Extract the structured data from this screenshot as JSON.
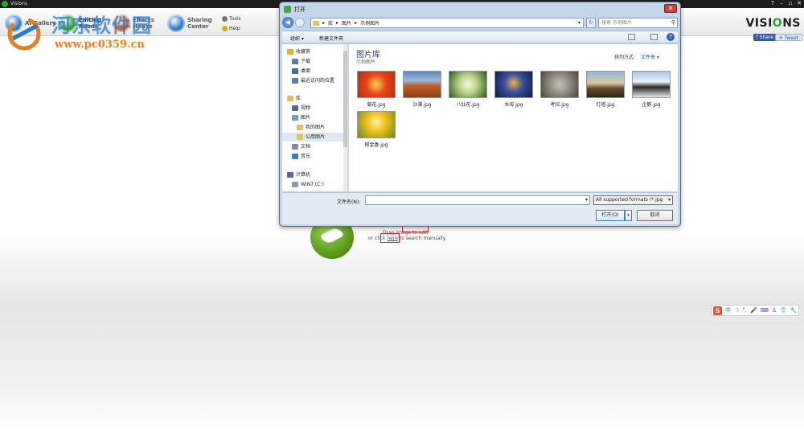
{
  "app": {
    "title": "Visions",
    "win_help": "?",
    "win_min": "–",
    "win_max": "▫",
    "win_close": "✕"
  },
  "toolbar": {
    "buttons": [
      {
        "label": "AI Gallery",
        "color": "#2a78c9"
      },
      {
        "label": "Editing Room",
        "color": "#2aa32a"
      },
      {
        "label": "Effects House",
        "color": "#d45a1e"
      },
      {
        "label": "Sharing Center",
        "color": "#2a78c9"
      }
    ],
    "tools_label": "Tools",
    "help_label": "Help"
  },
  "brand": {
    "text_left": "VISI",
    "text_o": "O",
    "text_right": "NS",
    "accent": "#2aa32a"
  },
  "social": {
    "facebook": "f Share",
    "twitter": "✈ Tweet"
  },
  "watermark": {
    "title": "河东软件园",
    "url": "www.pc0359.cn"
  },
  "drop_area": {
    "line1": "Drag image to edit",
    "line2_prefix": "or click ",
    "line2_link": "here",
    "line2_suffix": " to search manually."
  },
  "ime": {
    "logo": "S",
    "items": [
      "中",
      "☽",
      "°,",
      "🎤",
      "⌨",
      "♙",
      "👕",
      "🔧"
    ]
  },
  "dialog": {
    "title": "打开",
    "close": "✕",
    "address": [
      "▸",
      "库",
      "▸",
      "图片",
      "▸",
      "示例图片"
    ],
    "search_placeholder": "搜索 示例图片",
    "organize": "组织 ▾",
    "new_folder": "新建文件夹",
    "help": "?",
    "nav_items": [
      {
        "label": "收藏夹",
        "icon": "star-icon",
        "color": "#e6b422",
        "level": 0
      },
      {
        "label": "下载",
        "icon": "download-icon",
        "color": "#4a7cc0",
        "level": 1
      },
      {
        "label": "桌面",
        "icon": "desktop-icon",
        "color": "#3a6db0",
        "level": 1
      },
      {
        "label": "最近访问的位置",
        "icon": "recent-icon",
        "color": "#5a7fa8",
        "level": 1
      },
      {
        "label": "库",
        "icon": "library-icon",
        "color": "#e8c258",
        "level": 0
      },
      {
        "label": "视频",
        "icon": "video-icon",
        "color": "#4c6b8a",
        "level": 1
      },
      {
        "label": "图片",
        "icon": "pictures-icon",
        "color": "#6aa0c8",
        "level": 1
      },
      {
        "label": "我的图片",
        "icon": "folder-icon",
        "color": "#e8c258",
        "level": 2
      },
      {
        "label": "公用图片",
        "icon": "folder-icon",
        "color": "#e8c258",
        "level": 2
      },
      {
        "label": "文档",
        "icon": "documents-icon",
        "color": "#7a8fa8",
        "level": 1
      },
      {
        "label": "音乐",
        "icon": "music-icon",
        "color": "#3a7ec8",
        "level": 1
      },
      {
        "label": "计算机",
        "icon": "computer-icon",
        "color": "#5a6f8a",
        "level": 0
      },
      {
        "label": "WIN7 (C:)",
        "icon": "drive-icon",
        "color": "#8a9cb2",
        "level": 1
      }
    ],
    "library_title": "图片库",
    "library_subtitle": "示例图片",
    "sort_label": "排列方式:",
    "sort_value": "文件夹 ▾",
    "thumbnails": [
      {
        "name": "菊花.jpg",
        "grad": "radial-gradient(circle, #f7d04a, #e6461b 45%, #b82a10)"
      },
      {
        "name": "沙漠.jpg",
        "grad": "linear-gradient(#5a86c4 0%, #9cb8d8 35%, #c2622a 55%, #8a3a16 100%)"
      },
      {
        "name": "八仙花.jpg",
        "grad": "radial-gradient(circle, #f4f7d8, #b9d48a 40%, #2e5a1e)"
      },
      {
        "name": "水母.jpg",
        "grad": "radial-gradient(circle at 50% 45%, #f0b24a, #3a4f9a 40%, #0b1a4a)"
      },
      {
        "name": "考拉.jpg",
        "grad": "radial-gradient(circle, #c8c2b8, #8a847a 50%, #4a463e)"
      },
      {
        "name": "灯塔.jpg",
        "grad": "linear-gradient(#8fb6dc 0%, #d8c8a0 45%, #6a4a2a 65%, #2a2418 100%)"
      },
      {
        "name": "企鹅.jpg",
        "grad": "linear-gradient(#a8c8e8 0%, #e8f0f8 40%, #2a2a2a 60%, #e8e8e8 100%)"
      },
      {
        "name": "郁金香.jpg",
        "grad": "radial-gradient(circle at 50% 40%, #fff2a0, #f0c01a 40%, #6a8a2a 100%)"
      }
    ],
    "filename_label": "文件名(N):",
    "filename_value": "",
    "filter": "All supported formats (*.jpg",
    "open": "打开(O)",
    "open_drop": "▾",
    "cancel": "取消"
  }
}
